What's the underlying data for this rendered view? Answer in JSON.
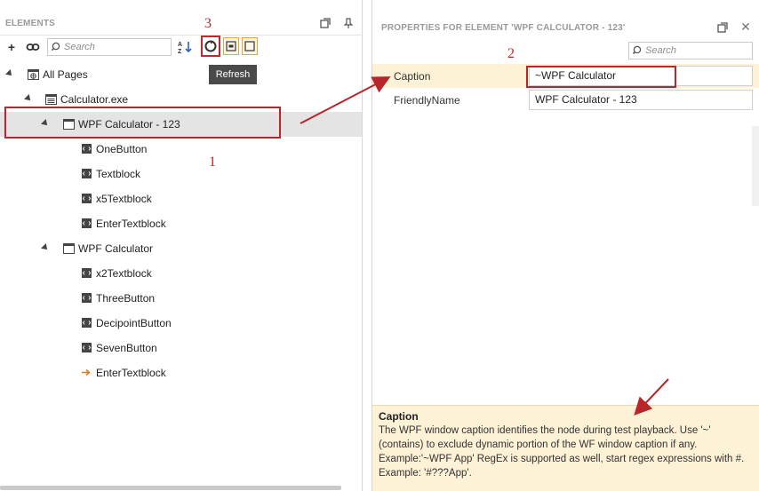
{
  "elements_panel": {
    "title": "ELEMENTS",
    "search_placeholder": "Search",
    "tooltip": "Refresh",
    "tree": [
      {
        "label": "All Pages",
        "icon": "globe-page-icon"
      },
      {
        "label": "Calculator.exe",
        "icon": "application-icon"
      },
      {
        "label": "WPF Calculator - 123",
        "icon": "window-icon",
        "selected": true
      },
      {
        "label": "OneButton",
        "icon": "element-icon"
      },
      {
        "label": "Textblock",
        "icon": "element-icon"
      },
      {
        "label": "x5Textblock",
        "icon": "element-icon"
      },
      {
        "label": "EnterTextblock",
        "icon": "element-icon"
      },
      {
        "label": "WPF Calculator",
        "icon": "window-icon"
      },
      {
        "label": "x2Textblock",
        "icon": "element-icon"
      },
      {
        "label": "ThreeButton",
        "icon": "element-icon"
      },
      {
        "label": "DecipointButton",
        "icon": "element-icon"
      },
      {
        "label": "SevenButton",
        "icon": "element-icon"
      },
      {
        "label": "EnterTextblock",
        "icon": "arrow-right-icon"
      }
    ]
  },
  "properties_panel": {
    "title": "PROPERTIES FOR ELEMENT 'WPF CALCULATOR - 123'",
    "search_placeholder": "Search",
    "properties": [
      {
        "name": "Caption",
        "value": "~WPF Calculator"
      },
      {
        "name": "FriendlyName",
        "value": "WPF Calculator - 123"
      }
    ],
    "description": {
      "title": "Caption",
      "text": "The WPF window caption identifies the node during test playback. Use '~' (contains) to exclude dynamic portion of the WF window caption if any. Example:'~WPF App' RegEx is supported as well, start regex expressions with #. Example: '#???App'."
    }
  },
  "annotations": {
    "step1": "1",
    "step2": "2",
    "step3": "3"
  },
  "colors": {
    "annotation_red": "#b8262c",
    "selection_gray": "#e4e4e4",
    "property_highlight": "#fdf1d6"
  }
}
